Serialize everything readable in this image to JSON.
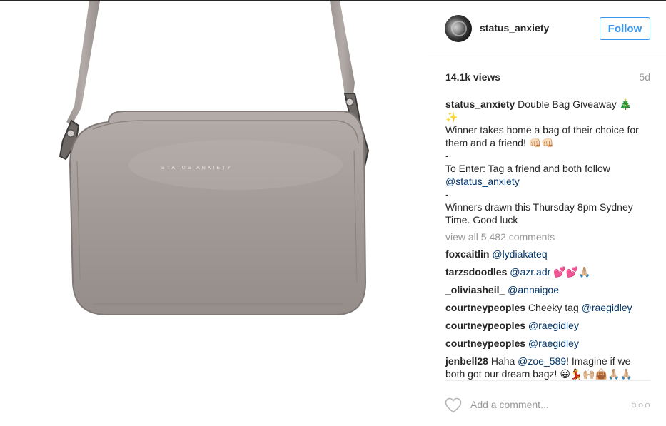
{
  "post": {
    "username": "status_anxiety",
    "follow_label": "Follow",
    "views": "14.1k views",
    "age": "5d",
    "caption": {
      "username": "status_anxiety",
      "lines": [
        "Double Bag Giveaway 🎄",
        "✨",
        "Winner takes home a bag of their choice for",
        "them and a friend! 👊🏻👊🏻",
        "-",
        "To Enter: Tag a friend and both follow",
        "@status_anxiety",
        "-",
        "Winners drawn this Thursday 8pm Sydney",
        "Time. Good luck"
      ]
    },
    "view_all_comments": "view all 5,482 comments",
    "comments": [
      {
        "user": "foxcaitlin",
        "mention": "@lydiakateq",
        "text": ""
      },
      {
        "user": "tarzsdoodles",
        "mention": "@azr.adr",
        "text": " 💕💕🙏🏼"
      },
      {
        "user": "_oliviasheil_",
        "mention": "@annaigoe",
        "text": ""
      },
      {
        "user": "courtneypeoples",
        "prefix": "Cheeky tag ",
        "mention": "@raegidley",
        "text": ""
      },
      {
        "user": "courtneypeoples",
        "mention": "@raegidley",
        "text": ""
      },
      {
        "user": "courtneypeoples",
        "mention": "@raegidley",
        "text": ""
      },
      {
        "user": "jenbell28",
        "prefix": "Haha ",
        "mention": "@zoe_589",
        "text": "! Imagine if we",
        "line2": "both got our dream bagz! 😀💃🙌🏼👜🙏🏼🙏🏼"
      }
    ],
    "add_comment_placeholder": "Add a comment...",
    "more_label": "○○○",
    "bag_logo_text": "STATUS ANXIETY"
  },
  "colors": {
    "accent": "#3897f0",
    "mention": "#003569",
    "muted": "#999999",
    "bag": "#a39b97"
  },
  "icons": {
    "heart": "heart-outline-icon",
    "more": "more-options-icon"
  }
}
